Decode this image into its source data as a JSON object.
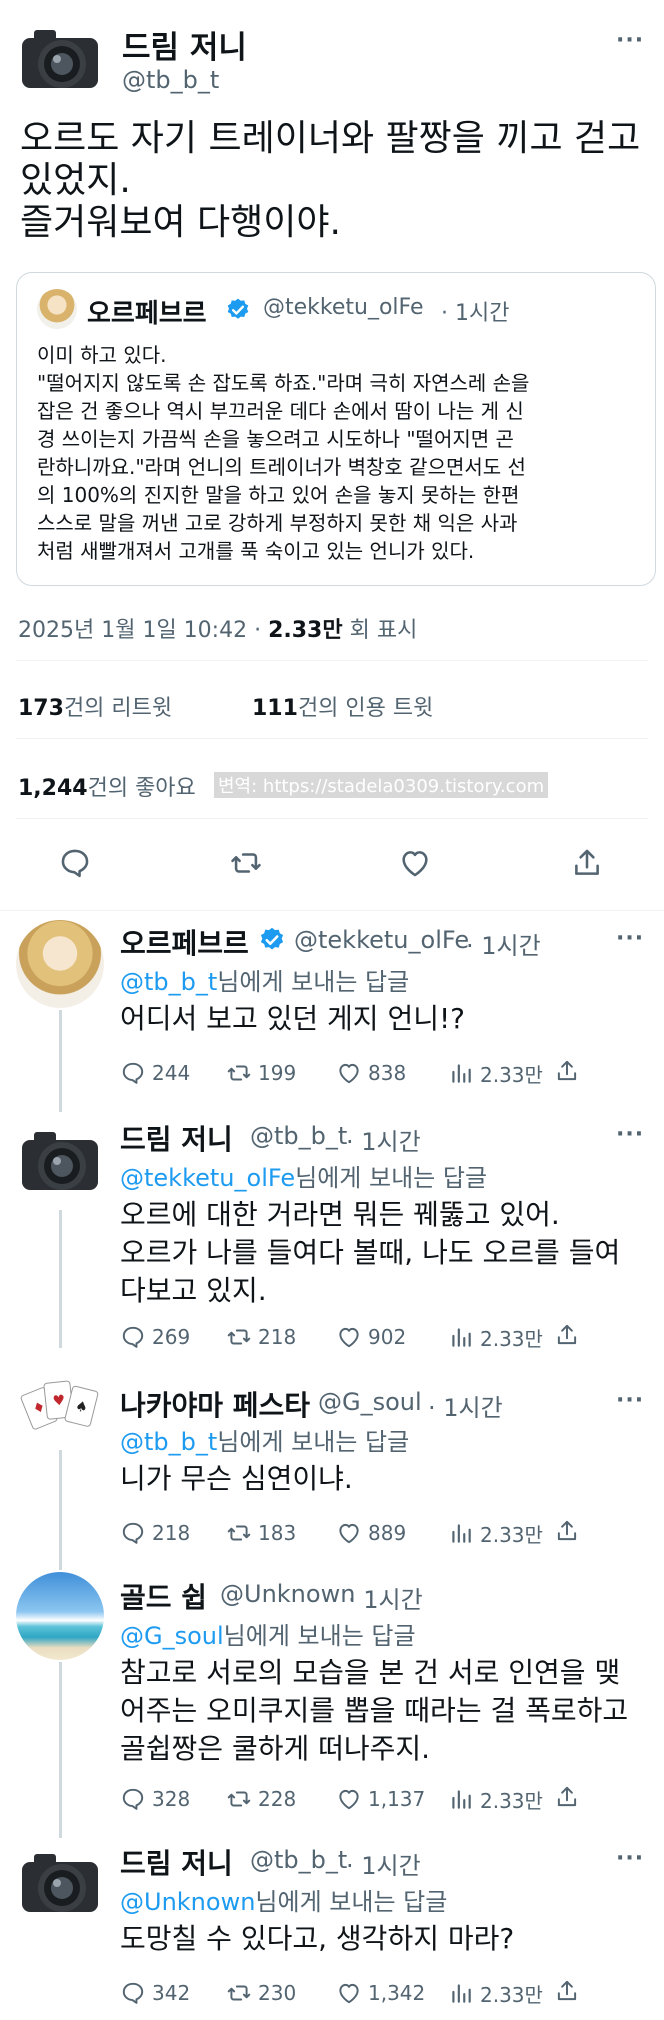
{
  "main_tweet": {
    "author_name": "드림 저니",
    "author_handle": "@tb_b_t",
    "text_line1": "오르도 자기 트레이너와 팔짱을 끼고 걷고",
    "text_line2": "있었지.",
    "text_line3": "즐거워보여 다행이야.",
    "quote": {
      "author_name": "오르페브르",
      "author_handle": "@tekketu_olFe",
      "time": "· 1시간",
      "lines": [
        "이미 하고 있다.",
        "\"떨어지지 않도록 손 잡도록 하죠.\"라며 극히 자연스레 손을",
        "잡은 건 좋으나 역시 부끄러운 데다 손에서 땀이 나는 게 신",
        "경 쓰이는지 가끔씩 손을 놓으려고 시도하나 \"떨어지면 곤",
        "란하니까요.\"라며 언니의 트레이너가 벽창호 같으면서도 선",
        "의 100%의 진지한 말을 하고 있어 손을 놓지 못하는 한편",
        "스스로 말을 꺼낸 고로 강하게 부정하지 못한 채 익은 사과",
        "처럼 새빨개져서 고개를 푹 숙이고 있는 언니가 있다."
      ]
    },
    "timestamp": "2025년 1월 1일 10:42 ·",
    "views_count": "2.33만",
    "views_label": "회 표시",
    "retweets_count": "173",
    "retweets_label": "건의 리트윗",
    "quotes_count": "111",
    "quotes_label": "건의 인용 트윗",
    "likes_count": "1,244",
    "likes_label": "건의 좋아요",
    "watermark": "변역: https://stadela0309.tistory.com"
  },
  "replies": [
    {
      "name": "오르페브르",
      "verified": true,
      "handle": "@tekketu_olFe",
      "time": "· 1시간",
      "reply_to_handle": "@tb_b_t",
      "reply_to_suffix": "님에게 보내는 답글",
      "text_lines": [
        "어디서 보고 있던 게지 언니!?"
      ],
      "replies": "244",
      "retweets": "199",
      "likes": "838",
      "views": "2.33만"
    },
    {
      "name": "드림 저니",
      "verified": false,
      "handle": "@tb_b_t",
      "time": "· 1시간",
      "reply_to_handle": "@tekketu_olFe",
      "reply_to_suffix": "님에게 보내는 답글",
      "text_lines": [
        "오르에 대한 거라면 뭐든 꿰뚫고 있어.",
        "오르가 나를 들여다 볼때, 나도 오르를 들여",
        "다보고 있지."
      ],
      "replies": "269",
      "retweets": "218",
      "likes": "902",
      "views": "2.33만"
    },
    {
      "name": "나카야마 페스타",
      "verified": false,
      "handle": "@G_soul",
      "time": "· 1시간",
      "reply_to_handle": "@tb_b_t",
      "reply_to_suffix": "님에게 보내는 답글",
      "text_lines": [
        "니가 무슨 심연이냐."
      ],
      "replies": "218",
      "retweets": "183",
      "likes": "889",
      "views": "2.33만"
    },
    {
      "name": "골드 쉽",
      "verified": false,
      "handle": "@Unknown",
      "time": "· 1시간",
      "reply_to_handle": "@G_soul",
      "reply_to_suffix": "님에게 보내는 답글",
      "text_lines": [
        "참고로 서로의 모습을 본 건 서로 인연을 맺",
        "어주는 오미쿠지를 뽑을 때라는 걸 폭로하고",
        "골쉽짱은 쿨하게 떠나주지."
      ],
      "replies": "328",
      "retweets": "228",
      "likes": "1,137",
      "views": "2.33만"
    },
    {
      "name": "드림 저니",
      "verified": false,
      "handle": "@tb_b_t",
      "time": "· 1시간",
      "reply_to_handle": "@Unknown",
      "reply_to_suffix": "님에게 보내는 답글",
      "text_lines": [
        "도망칠 수 있다고, 생각하지 마라?"
      ],
      "replies": "342",
      "retweets": "230",
      "likes": "1,342",
      "views": "2.33만"
    }
  ],
  "colors": {
    "accent": "#1d9bf0",
    "text": "#0f1419",
    "muted": "#536471",
    "border": "#cfd9de"
  },
  "icons": [
    "camera-avatar-icon",
    "more-icon",
    "verified-icon",
    "reply-icon",
    "retweet-icon",
    "like-icon",
    "share-icon",
    "views-icon"
  ]
}
